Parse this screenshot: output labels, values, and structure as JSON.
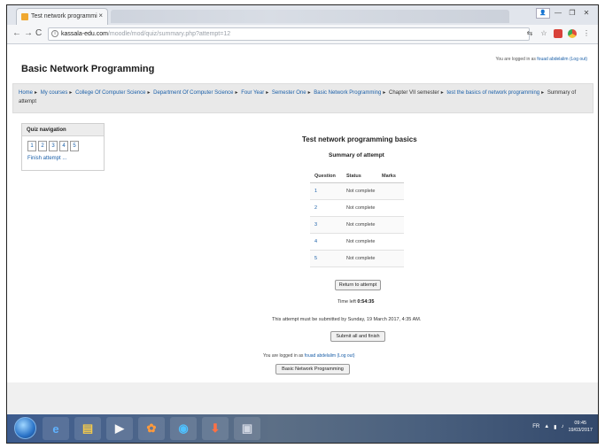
{
  "browser": {
    "tab_title": "Test network programmi",
    "tab_close": "×",
    "window_controls": [
      "—",
      "❐",
      "✕"
    ],
    "back": "←",
    "forward": "→",
    "reload": "C",
    "url_host": "kassala-edu.com",
    "url_path": "/moodle/mod/quiz/summary.php?attempt=12"
  },
  "header": {
    "site_title": "Basic Network Programming",
    "login_prefix": "You are logged in as ",
    "login_user": "fouad abdelalim",
    "login_logout": "(Log out)"
  },
  "breadcrumb": {
    "items": [
      "Home",
      "My courses",
      "College Of Computer Science",
      "Department Of Computer Science",
      "Four Year",
      "Semester One",
      "Basic Network Programming",
      "Chapter VII semester",
      "test the basics of network programming",
      "Summary of attempt"
    ]
  },
  "quiz_nav": {
    "title": "Quiz navigation",
    "buttons": [
      "1",
      "2",
      "3",
      "4",
      "5"
    ],
    "finish": "Finish attempt ..."
  },
  "main": {
    "quiz_title": "Test network programming basics",
    "summary_title": "Summary of attempt",
    "table": {
      "headers": [
        "Question",
        "Status",
        "Marks"
      ],
      "rows": [
        {
          "q": "1",
          "status": "Not complete",
          "marks": ""
        },
        {
          "q": "2",
          "status": "Not complete",
          "marks": ""
        },
        {
          "q": "3",
          "status": "Not complete",
          "marks": ""
        },
        {
          "q": "4",
          "status": "Not complete",
          "marks": ""
        },
        {
          "q": "5",
          "status": "Not complete",
          "marks": ""
        }
      ]
    },
    "return_button": "Return to attempt",
    "time_left_label": "Time left ",
    "time_left_value": "0:54:35",
    "deadline": "This attempt must be submitted by Sunday, 19 March 2017, 4:35 AM.",
    "submit_button": "Submit all and finish",
    "logged_prefix": "You are logged in as ",
    "logged_user": "fouad abdelalim",
    "logged_logout": "(Log out)",
    "course_button": "Basic Network Programming"
  },
  "taskbar": {
    "tray_lang": "FR",
    "time": "09:45",
    "date": "19/03/2017"
  }
}
